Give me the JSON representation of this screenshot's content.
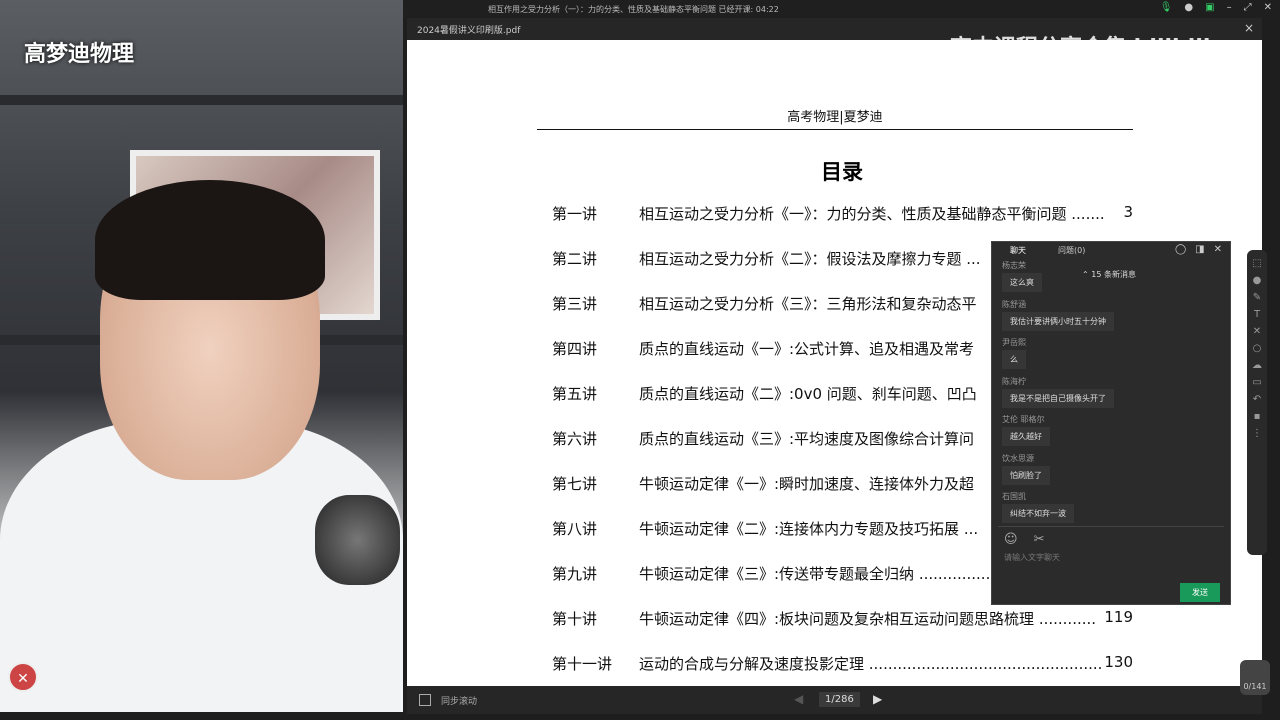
{
  "video": {
    "watermark": "高梦迪物理",
    "watermark_right": "高中课程分享合集 bilibili"
  },
  "titlebar": {
    "title": "相互作用之受力分析（一）：力的分类、性质及基础静态平衡问题   已经开课: 04:22",
    "controls": [
      "mic-icon",
      "camera-icon",
      "grid-icon",
      "minimize-icon",
      "fullscreen-icon",
      "close-icon"
    ]
  },
  "tab": {
    "filename": "2024暑假讲义印刷版.pdf",
    "close": "×"
  },
  "document": {
    "header": "高考物理|夏梦迪",
    "toc_title": "目录",
    "entries": [
      {
        "label": "第一讲",
        "title": "相互运动之受力分析《一》：力的分类、性质及基础静态平衡问题 .......",
        "page": "3"
      },
      {
        "label": "第二讲",
        "title": "相互运动之受力分析《二》：假设法及摩擦力专题 ...",
        "page": ""
      },
      {
        "label": "第三讲",
        "title": "相互运动之受力分析《三》：三角形法和复杂动态平",
        "page": ""
      },
      {
        "label": "第四讲",
        "title": "质点的直线运动《一》:公式计算、追及相遇及常考",
        "page": ""
      },
      {
        "label": "第五讲",
        "title": "质点的直线运动《二》:0v0 问题、刹车问题、凹凸",
        "page": ""
      },
      {
        "label": "第六讲",
        "title": "质点的直线运动《三》:平均速度及图像综合计算问",
        "page": ""
      },
      {
        "label": "第七讲",
        "title": "牛顿运动定律《一》:瞬时加速度、连接体外力及超",
        "page": ""
      },
      {
        "label": "第八讲",
        "title": "牛顿运动定律《二》:连接体内力专题及技巧拓展 ...",
        "page": ""
      },
      {
        "label": "第九讲",
        "title": "牛顿运动定律《三》:传送带专题最全归纳 ..............................",
        "page": ""
      },
      {
        "label": "第十讲",
        "title": "牛顿运动定律《四》:板块问题及复杂相互运动问题思路梳理 ............",
        "page": "119"
      },
      {
        "label": "第十一讲",
        "title": "运动的合成与分解及速度投影定理 ..................................................................",
        "page": "130"
      }
    ]
  },
  "bottombar": {
    "sync_label": "同步滚动",
    "page_indicator": "1/286"
  },
  "page_badge": "0/141",
  "chat": {
    "tabs": [
      "聊天",
      "问题(0)"
    ],
    "new_messages": "⌃ 15 条新消息",
    "messages": [
      {
        "user": "杨志荣",
        "text": "这么爽"
      },
      {
        "user": "陈舒涵",
        "text": "我估计要讲俩小时五十分钟"
      },
      {
        "user": "尹岳熙",
        "text": "么"
      },
      {
        "user": "陈海柠",
        "text": "我是不是把自己摄像头开了"
      },
      {
        "user": "艾伦 耶格尔",
        "text": "越久越好"
      },
      {
        "user": "饮水思源",
        "text": "怕刷脸了"
      },
      {
        "user": "石国凯",
        "text": "纠结不如弃一波"
      }
    ],
    "placeholder": "请输入文字聊天",
    "send": "发送"
  }
}
